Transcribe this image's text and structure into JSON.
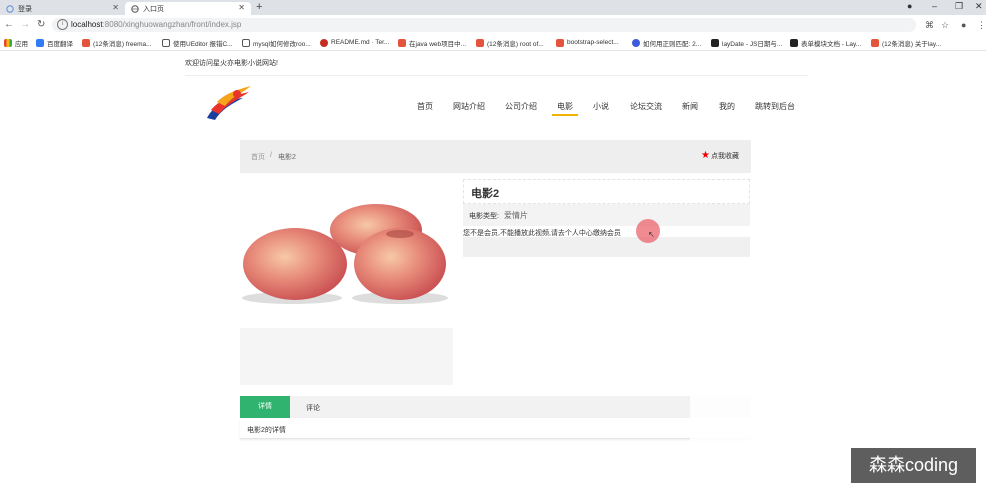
{
  "browser": {
    "tabs": [
      {
        "title": "登录",
        "icon": "globe-icon"
      },
      {
        "title": "入口页",
        "icon": "globe-icon"
      }
    ],
    "new_tab": "+",
    "url_host": "localhost",
    "url_path": ":8080/xinghuowangzhan/front/index.jsp",
    "window_controls": [
      "●",
      "–",
      "❐",
      "✕"
    ],
    "bookmarks": [
      {
        "label": "应用",
        "color": "#4285f4"
      },
      {
        "label": "百度翻译",
        "color": "#2f7cf6"
      },
      {
        "label": "(12条消息) freema...",
        "color": "#e4543c"
      },
      {
        "label": "使用UEditor 报错C...",
        "color": "#555555"
      },
      {
        "label": "mysql如何修改roo...",
        "color": "#555555"
      },
      {
        "label": "README.md · Ter...",
        "color": "#c62d1f"
      },
      {
        "label": "在java web项目中...",
        "color": "#e4543c"
      },
      {
        "label": "(12条消息) root of...",
        "color": "#e4543c"
      },
      {
        "label": "bootstrap-select...",
        "color": "#e4543c"
      },
      {
        "label": "如何用正则匹配: 2...",
        "color": "#3b5bdb"
      },
      {
        "label": "layDate - JS日期与...",
        "color": "#222222"
      },
      {
        "label": "表单模块文档 - Lay...",
        "color": "#222222"
      },
      {
        "label": "(12条消息) 关于lay...",
        "color": "#e4543c"
      }
    ]
  },
  "page": {
    "welcome": "欢迎访问星火亦电影小说网站!",
    "nav": [
      "首页",
      "网站介绍",
      "公司介绍",
      "电影",
      "小说",
      "论坛交流",
      "新闻",
      "我的",
      "跳转到后台"
    ],
    "active_nav": "电影",
    "breadcrumb": {
      "home": "首页",
      "sep": "/",
      "current": "电影2"
    },
    "favorite_label": "点我收藏",
    "movie_title": "电影2",
    "type_label": "电影类型:",
    "type_value": "爱情片",
    "notice": "您不是会员,不能播放此视频,请去个人中心缴纳会员",
    "tabs": {
      "detail": "详情",
      "comment": "评论"
    },
    "detail_text": "电影2的详情"
  },
  "watermark": "森森coding",
  "colors": {
    "accent_green": "#2fb36f",
    "nav_underline": "#f0b400",
    "star": "#e00000"
  }
}
